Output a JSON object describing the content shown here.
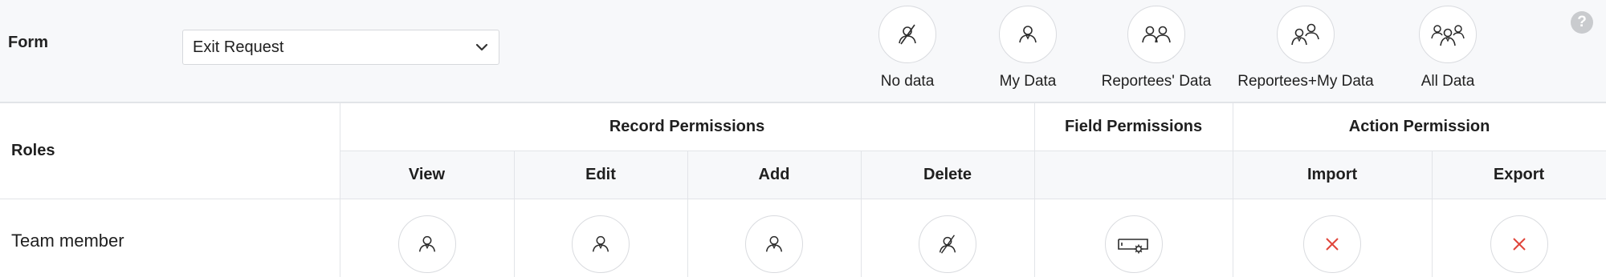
{
  "form": {
    "label": "Form",
    "selected": "Exit Request"
  },
  "legend": [
    {
      "icon": "no-data-icon",
      "label": "No data"
    },
    {
      "icon": "my-data-icon",
      "label": "My Data"
    },
    {
      "icon": "reportees-data-icon",
      "label": "Reportees' Data"
    },
    {
      "icon": "reportees-my-data-icon",
      "label": "Reportees+My Data"
    },
    {
      "icon": "all-data-icon",
      "label": "All Data"
    }
  ],
  "help": {
    "label": "?"
  },
  "table": {
    "roles_header": "Roles",
    "groups": {
      "record": "Record Permissions",
      "field": "Field Permissions",
      "action": "Action Permission"
    },
    "columns": {
      "view": "View",
      "edit": "Edit",
      "add": "Add",
      "delete": "Delete",
      "field": "",
      "import": "Import",
      "export": "Export"
    },
    "rows": [
      {
        "role": "Team member",
        "view": "my-data-icon",
        "edit": "my-data-icon",
        "add": "my-data-icon",
        "delete": "no-data-icon",
        "field": "field-settings-icon",
        "import": "denied-x-icon",
        "export": "denied-x-icon"
      }
    ]
  },
  "colors": {
    "accent_red": "#e0453a",
    "icon_stroke": "#2b2b2b",
    "header_bg": "#f7f8fa",
    "border": "#e2e4e8"
  }
}
